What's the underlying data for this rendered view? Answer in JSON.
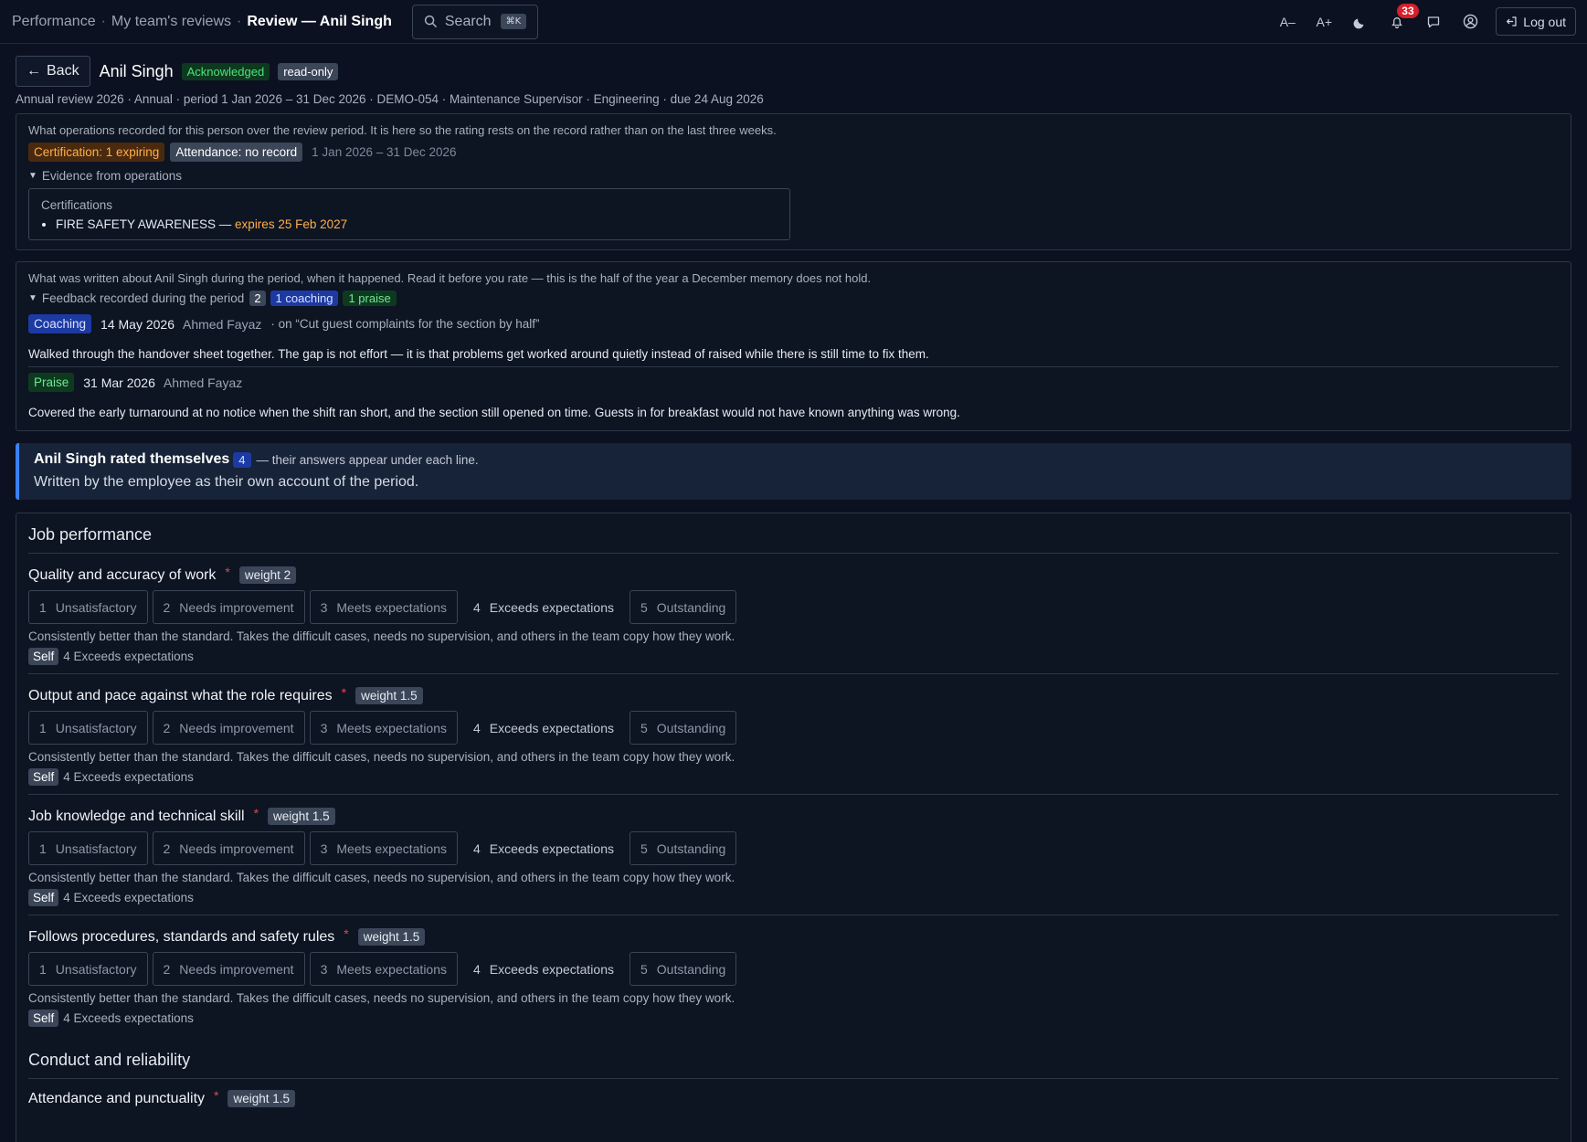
{
  "topbar": {
    "breadcrumbs": [
      "Performance",
      "My team's reviews",
      "Review — Anil Singh"
    ],
    "search": {
      "label": "Search",
      "shortcut": "⌘K"
    },
    "font_decrease": "A–",
    "font_increase": "A+",
    "notifications_count": "33",
    "logout_label": "Log out"
  },
  "header": {
    "back_label": "Back",
    "name": "Anil Singh",
    "status": "Acknowledged",
    "mode": "read-only",
    "meta": "Annual review 2026 · Annual · period 1 Jan 2026 – 31 Dec 2026 · DEMO-054 · Maintenance Supervisor · Engineering · due 24 Aug 2026"
  },
  "operations": {
    "intro": "What operations recorded for this person over the review period. It is here so the rating rests on the record rather than on the last three weeks.",
    "cert_tag": "Certification: 1 expiring",
    "attendance_tag": "Attendance: no record",
    "period": "1 Jan 2026 – 31 Dec 2026",
    "evidence_label": "Evidence from operations",
    "certs_heading": "Certifications",
    "cert_name": "FIRE SAFETY AWARENESS — ",
    "cert_expiry": "expires 25 Feb 2027"
  },
  "feedback": {
    "intro": "What was written about Anil Singh during the period, when it happened. Read it before you rate — this is the half of the year a December memory does not hold.",
    "summary_label": "Feedback recorded during the period",
    "total": "2",
    "coaching_count": "1 coaching",
    "praise_count": "1 praise",
    "entries": [
      {
        "type": "Coaching",
        "date": "14 May 2026",
        "author": "Ahmed Fayaz",
        "on": "· on “Cut guest complaints for the section by half”",
        "text": "Walked through the handover sheet together. The gap is not effort — it is that problems get worked around quietly instead of raised while there is still time to fix them."
      },
      {
        "type": "Praise",
        "date": "31 Mar 2026",
        "author": "Ahmed Fayaz",
        "on": "",
        "text": "Covered the early turnaround at no notice when the shift ran short, and the section still opened on time. Guests in for breakfast would not have known anything was wrong."
      }
    ]
  },
  "self_rating": {
    "title": "Anil Singh rated themselves",
    "count": "4",
    "rest": "— their answers appear under each line.",
    "subtitle": "Written by the employee as their own account of the period."
  },
  "scale": [
    {
      "num": "1",
      "label": "Unsatisfactory"
    },
    {
      "num": "2",
      "label": "Needs improvement"
    },
    {
      "num": "3",
      "label": "Meets expectations"
    },
    {
      "num": "4",
      "label": "Exceeds expectations"
    },
    {
      "num": "5",
      "label": "Outstanding"
    }
  ],
  "self_label": "Self",
  "sections": [
    {
      "title": "Job performance",
      "criteria": [
        {
          "name": "Quality and accuracy of work",
          "weight": "weight 2",
          "desc": "Consistently better than the standard. Takes the difficult cases, needs no supervision, and others in the team copy how they work.",
          "self": "4 Exceeds expectations"
        },
        {
          "name": "Output and pace against what the role requires",
          "weight": "weight 1.5",
          "desc": "Consistently better than the standard. Takes the difficult cases, needs no supervision, and others in the team copy how they work.",
          "self": "4 Exceeds expectations"
        },
        {
          "name": "Job knowledge and technical skill",
          "weight": "weight 1.5",
          "desc": "Consistently better than the standard. Takes the difficult cases, needs no supervision, and others in the team copy how they work.",
          "self": "4 Exceeds expectations"
        },
        {
          "name": "Follows procedures, standards and safety rules",
          "weight": "weight 1.5",
          "desc": "Consistently better than the standard. Takes the difficult cases, needs no supervision, and others in the team copy how they work.",
          "self": "4 Exceeds expectations"
        }
      ]
    },
    {
      "title": "Conduct and reliability",
      "criteria": [
        {
          "name": "Attendance and punctuality",
          "weight": "weight 1.5"
        }
      ]
    }
  ],
  "colors": {
    "background": "#0b1120",
    "accent_blue": "#3b82f6",
    "status_green": "#4ee27b",
    "warning_orange": "#ffae4a",
    "notification_red": "#d61f2c"
  }
}
